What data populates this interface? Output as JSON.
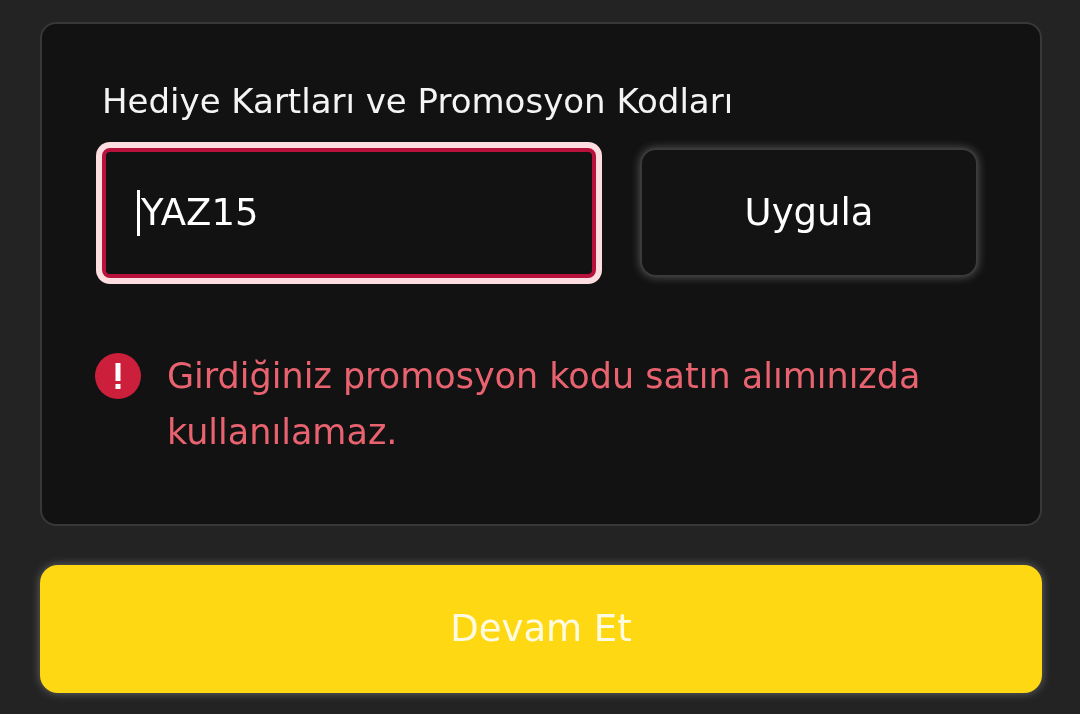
{
  "section": {
    "title": "Hediye Kartları ve Promosyon Kodları"
  },
  "promo_field": {
    "value": "YAZ15",
    "focused": true,
    "invalid": true
  },
  "apply_button": {
    "label": "Uygula"
  },
  "error": {
    "message": "Girdiğiniz promosyon kodu satın alımınızda kullanılamaz."
  },
  "continue_button": {
    "label": "Devam Et"
  }
}
